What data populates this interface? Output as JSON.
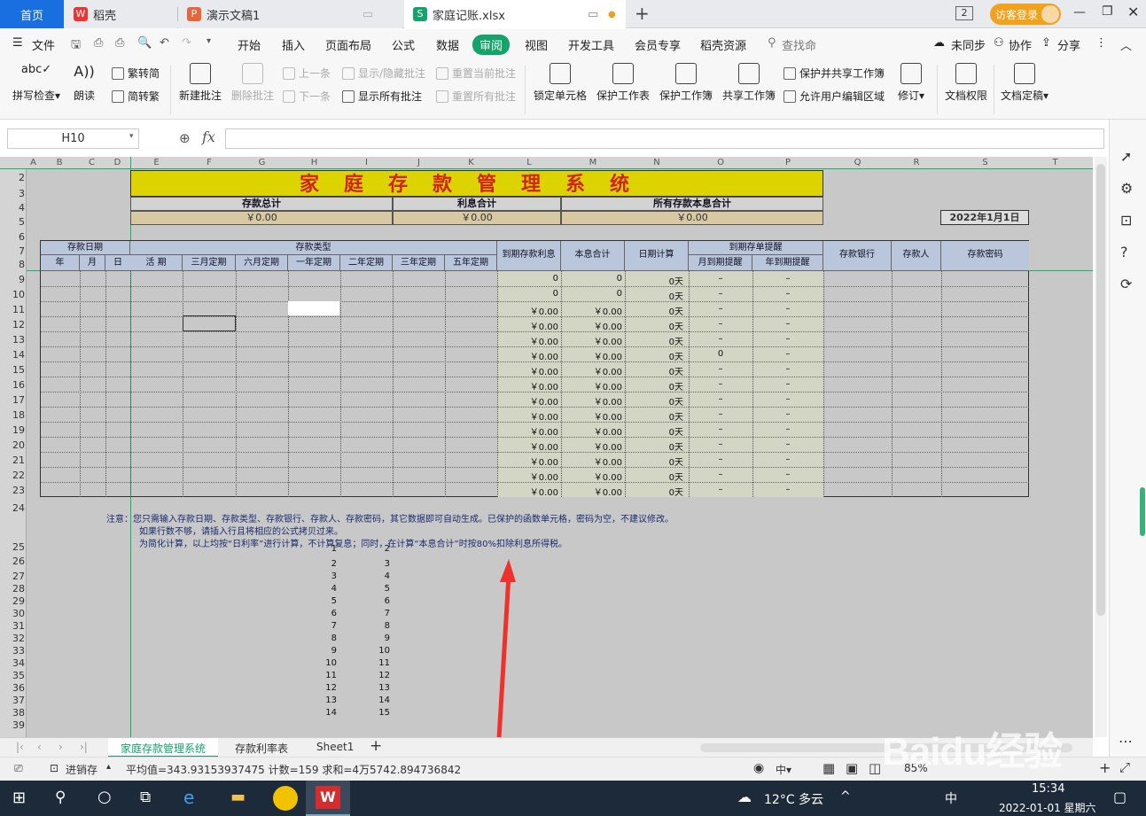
{
  "tabs": {
    "home": "首页",
    "daoke": "稻壳",
    "ppt": "演示文稿1",
    "xls": "家庭记账.xlsx",
    "badge": "2",
    "visitor": "访客登录"
  },
  "menu": {
    "file": "文件",
    "items": [
      "开始",
      "插入",
      "页面布局",
      "公式",
      "数据",
      "审阅",
      "视图",
      "开发工具",
      "会员专享",
      "稻壳资源"
    ],
    "search": "查找命",
    "unsync": "未同步",
    "collab": "协作",
    "share": "分享"
  },
  "ribbon": {
    "spell": "拼写检查",
    "read": "朗读",
    "trad": "繁转简",
    "simp": "简转繁",
    "new_comment": "新建批注",
    "del_comment": "删除批注",
    "prev": "上一条",
    "next": "下一条",
    "showhide": "显示/隐藏批注",
    "showall": "显示所有批注",
    "reset_cur": "重置当前批注",
    "reset_all": "重置所有批注",
    "lock": "锁定单元格",
    "prot_sheet": "保护工作表",
    "prot_book": "保护工作簿",
    "share_book": "共享工作簿",
    "prot_share": "保护并共享工作簿",
    "allow_edit": "允许用户编辑区域",
    "revise": "修订",
    "doc_perm": "文档权限",
    "finalize": "文档定稿"
  },
  "formula": {
    "namebox": "H10",
    "fx": "fx",
    "value": ""
  },
  "sheet": {
    "cols": [
      "A",
      "B",
      "C",
      "D",
      "E",
      "F",
      "G",
      "H",
      "I",
      "J",
      "K",
      "L",
      "M",
      "N",
      "O",
      "P",
      "Q",
      "R",
      "S",
      "T"
    ],
    "rows": [
      "2",
      "3",
      "4",
      "5",
      "6",
      "7",
      "8",
      "9",
      "10",
      "11",
      "12",
      "13",
      "14",
      "15",
      "16",
      "17",
      "18",
      "19",
      "20",
      "21",
      "22",
      "23",
      "24",
      "25",
      "26",
      "27",
      "28",
      "29",
      "30",
      "31",
      "32",
      "33",
      "34",
      "35",
      "36",
      "37",
      "38",
      "39"
    ],
    "title": "家庭存款管理系统",
    "sum_labels": [
      "存款总计",
      "利息合计",
      "所有存款本息合计"
    ],
    "sum_values": [
      "￥0.00",
      "￥0.00",
      "￥0.00"
    ],
    "date": "2022年1月1日",
    "hdr_date": "存款日期",
    "hdr_type": "存款类型",
    "hdr_interest": "到期存款利息",
    "hdr_total": "本息合计",
    "hdr_days": "日期计算",
    "hdr_remind": "到期存单提醒",
    "hdr_bank": "存款银行",
    "hdr_person": "存款人",
    "hdr_pwd": "存款密码",
    "sub_date": [
      "年",
      "月",
      "日"
    ],
    "sub_type": [
      "活    期",
      "三月定期",
      "六月定期",
      "一年定期",
      "二年定期",
      "三年定期",
      "五年定期"
    ],
    "sub_remind": [
      "月到期提醒",
      "年到期提醒"
    ],
    "data_rows": [
      [
        "0",
        "0",
        "0天",
        "–",
        "–"
      ],
      [
        "0",
        "0",
        "0天",
        "–",
        "–"
      ],
      [
        "￥0.00",
        "￥0.00",
        "0天",
        "–",
        "–"
      ],
      [
        "￥0.00",
        "￥0.00",
        "0天",
        "–",
        "–"
      ],
      [
        "￥0.00",
        "￥0.00",
        "0天",
        "–",
        "–"
      ],
      [
        "￥0.00",
        "￥0.00",
        "0天",
        "0",
        "–"
      ],
      [
        "￥0.00",
        "￥0.00",
        "0天",
        "–",
        "–"
      ],
      [
        "￥0.00",
        "￥0.00",
        "0天",
        "–",
        "–"
      ],
      [
        "￥0.00",
        "￥0.00",
        "0天",
        "–",
        "–"
      ],
      [
        "￥0.00",
        "￥0.00",
        "0天",
        "–",
        "–"
      ],
      [
        "￥0.00",
        "￥0.00",
        "0天",
        "–",
        "–"
      ],
      [
        "￥0.00",
        "￥0.00",
        "0天",
        "–",
        "–"
      ],
      [
        "￥0.00",
        "￥0.00",
        "0天",
        "–",
        "–"
      ],
      [
        "￥0.00",
        "￥0.00",
        "0天",
        "–",
        "–"
      ],
      [
        "￥0.00",
        "￥0.00",
        "0天",
        "–",
        "–"
      ]
    ],
    "notes": [
      "注意：您只需输入存款日期、存款类型、存款银行、存款人、存款密码，其它数据即可自动生成。已保护的函数单元格，密码为空，不建议修改。",
      "如果行数不够，请插入行且将相应的公式拷贝过来。",
      "为简化计算，以上均按“日利率”进行计算，不计算复息；同时，在计算“本息合计”时按80%扣除利息所得税。"
    ],
    "list_a": [
      "1",
      "2",
      "3",
      "4",
      "5",
      "6",
      "7",
      "8",
      "9",
      "10",
      "11",
      "12",
      "13",
      "14"
    ],
    "list_b": [
      "2",
      "3",
      "4",
      "5",
      "6",
      "7",
      "8",
      "9",
      "10",
      "11",
      "12",
      "13",
      "14",
      "15"
    ]
  },
  "sheettabs": [
    "家庭存款管理系统",
    "存款利率表",
    "Sheet1"
  ],
  "status": {
    "backup": "进销存",
    "stats": "平均值=343.93153937475  计数=159  求和=4万5742.894736842",
    "zoom": "85%"
  },
  "taskbar": {
    "weather": "12°C  多云",
    "time": "15:34",
    "date": "2022-01-01 星期六",
    "ime": "中"
  },
  "watermark": "Baidu经验"
}
